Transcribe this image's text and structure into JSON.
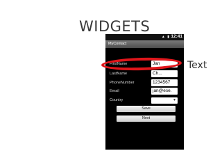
{
  "slide": {
    "title": "WIDGETS",
    "callout_label": "Text",
    "highlight_color": "#e0161b"
  },
  "phone": {
    "status_time": "12:41",
    "status_icons_text": "▲ ▮",
    "app_title": "MyContact",
    "form": {
      "rows": [
        {
          "label": "FirstName",
          "value": "Jan"
        },
        {
          "label": "LastName",
          "value": "Ch..."
        },
        {
          "label": "PhoneNumber",
          "value": "1234567"
        },
        {
          "label": "Email",
          "value": "jan@ese."
        },
        {
          "label": "Country",
          "value": ""
        }
      ],
      "save_label": "Save",
      "next_label": "Next"
    }
  }
}
